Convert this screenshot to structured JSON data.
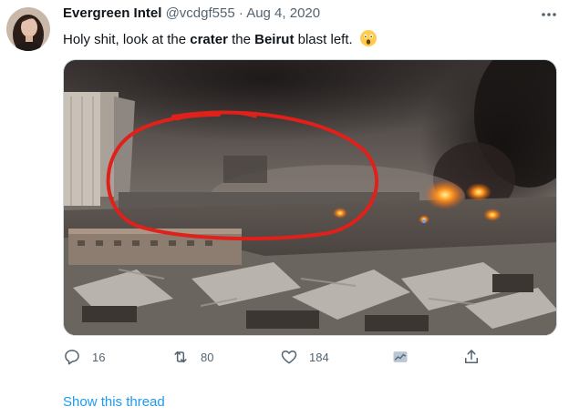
{
  "tweet": {
    "display_name": "Evergreen Intel",
    "handle": "@vcdgf555",
    "separator": "·",
    "date": "Aug 4, 2020",
    "text": {
      "part1": "Holy shit, look at the ",
      "bold1": "crater",
      "part2": " the ",
      "bold2": "Beirut",
      "part3": " blast left."
    },
    "emoji": "astonished-face-emoji"
  },
  "actions": {
    "reply_count": "16",
    "retweet_count": "80",
    "like_count": "184"
  },
  "thread_link": "Show this thread",
  "colors": {
    "accent": "#1d9bf0",
    "secondary_text": "#536471",
    "annotation_circle": "#e0201b"
  }
}
